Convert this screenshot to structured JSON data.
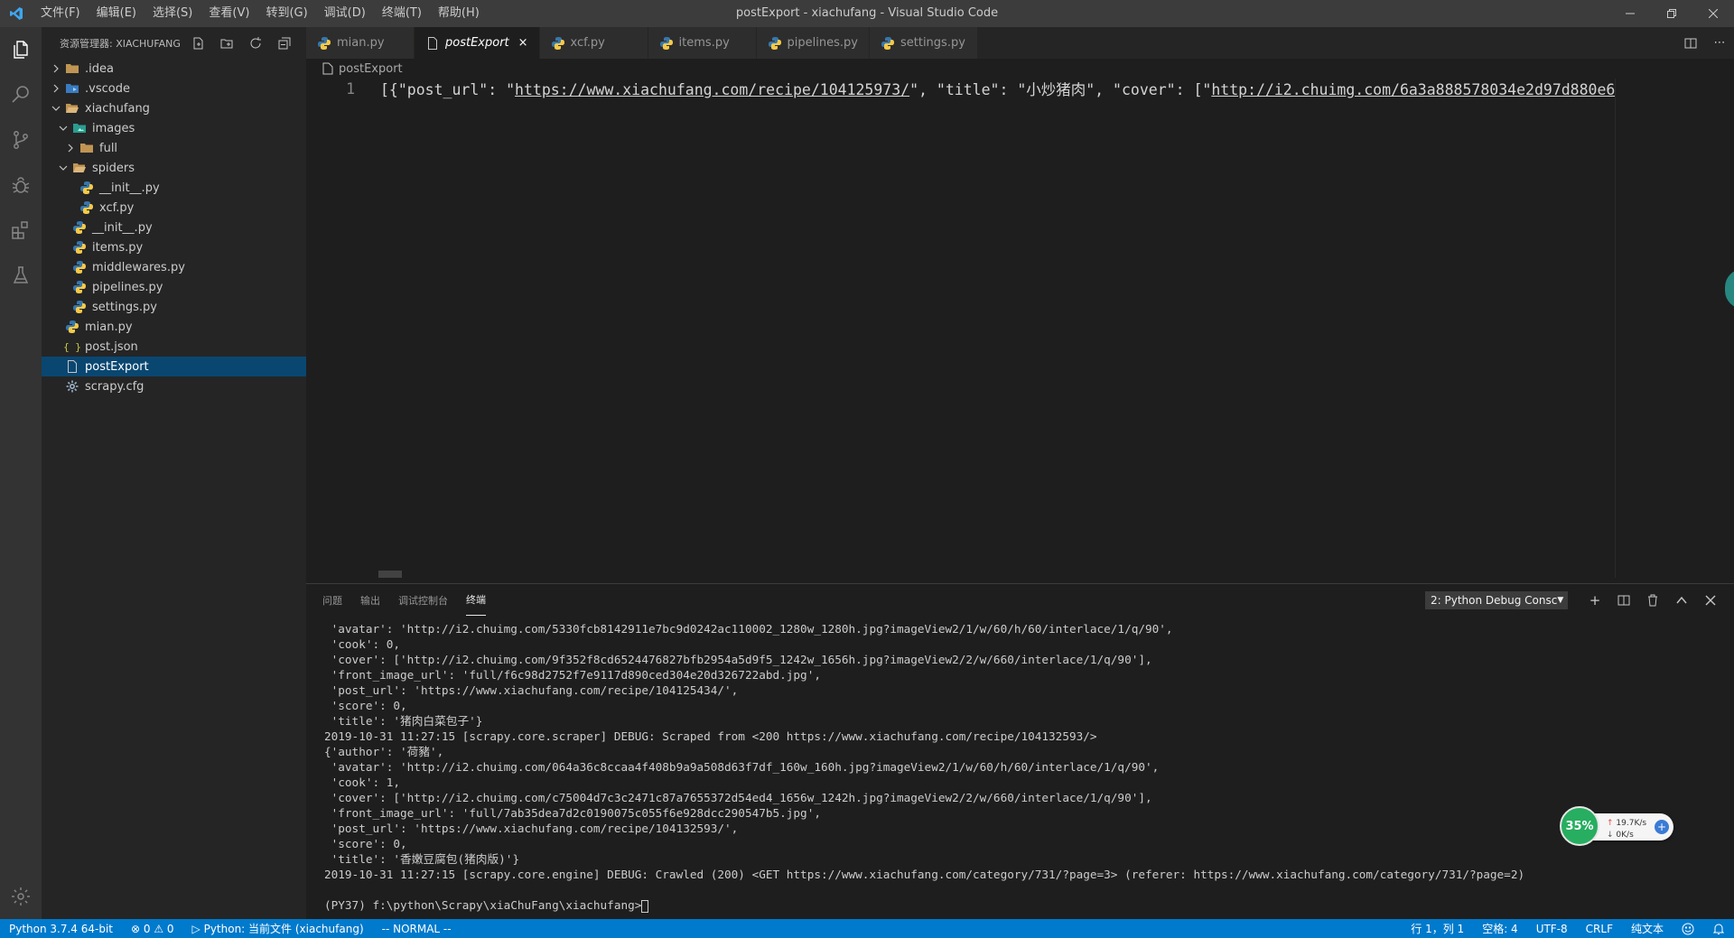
{
  "window": {
    "title": "postExport - xiachufang - Visual Studio Code",
    "menu": [
      "文件(F)",
      "编辑(E)",
      "选择(S)",
      "查看(V)",
      "转到(G)",
      "调试(D)",
      "终端(T)",
      "帮助(H)"
    ]
  },
  "sidebar": {
    "title": "资源管理器: XIACHUFANG",
    "tree": [
      {
        "label": ".idea",
        "indent": 0,
        "chevron": "right",
        "icon": "folder-icon"
      },
      {
        "label": ".vscode",
        "indent": 0,
        "chevron": "right",
        "icon": "folder-vscode-icon"
      },
      {
        "label": "xiachufang",
        "indent": 0,
        "chevron": "down",
        "icon": "folder-open-icon"
      },
      {
        "label": "images",
        "indent": 1,
        "chevron": "down",
        "icon": "folder-images-icon"
      },
      {
        "label": "full",
        "indent": 2,
        "chevron": "right",
        "icon": "folder-icon"
      },
      {
        "label": "spiders",
        "indent": 1,
        "chevron": "down",
        "icon": "folder-open-icon"
      },
      {
        "label": "__init__.py",
        "indent": 2,
        "chevron": "",
        "icon": "python-icon"
      },
      {
        "label": "xcf.py",
        "indent": 2,
        "chevron": "",
        "icon": "python-icon"
      },
      {
        "label": "__init__.py",
        "indent": 1,
        "chevron": "",
        "icon": "python-icon"
      },
      {
        "label": "items.py",
        "indent": 1,
        "chevron": "",
        "icon": "python-icon"
      },
      {
        "label": "middlewares.py",
        "indent": 1,
        "chevron": "",
        "icon": "python-icon"
      },
      {
        "label": "pipelines.py",
        "indent": 1,
        "chevron": "",
        "icon": "python-icon"
      },
      {
        "label": "settings.py",
        "indent": 1,
        "chevron": "",
        "icon": "python-icon"
      },
      {
        "label": "mian.py",
        "indent": 0,
        "chevron": "",
        "icon": "python-icon"
      },
      {
        "label": "post.json",
        "indent": 0,
        "chevron": "",
        "icon": "json-icon"
      },
      {
        "label": "postExport",
        "indent": 0,
        "chevron": "",
        "icon": "file-icon",
        "selected": true
      },
      {
        "label": "scrapy.cfg",
        "indent": 0,
        "chevron": "",
        "icon": "gear-icon"
      }
    ]
  },
  "tabs": [
    {
      "label": "mian.py",
      "icon": "python-icon"
    },
    {
      "label": "postExport",
      "icon": "file-icon",
      "active": true
    },
    {
      "label": "xcf.py",
      "icon": "python-icon"
    },
    {
      "label": "items.py",
      "icon": "python-icon"
    },
    {
      "label": "pipelines.py",
      "icon": "python-icon"
    },
    {
      "label": "settings.py",
      "icon": "python-icon"
    }
  ],
  "editor": {
    "breadcrumb": "postExport",
    "line_number": "1",
    "code_parts": [
      {
        "text": "[{\"post_url\": \"",
        "u": false
      },
      {
        "text": "https://www.xiachufang.com/recipe/104125973/",
        "u": true
      },
      {
        "text": "\", \"title\": \"小炒猪肉\", \"cover\": [\"",
        "u": false
      },
      {
        "text": "http://i2.chuimg.com/6a3a888578034e2d97d880e6",
        "u": true
      }
    ]
  },
  "panel": {
    "tabs": [
      "问题",
      "输出",
      "调试控制台",
      "终端"
    ],
    "active_tab": 3,
    "terminal_select": "2: Python Debug Consc",
    "terminal_lines": [
      " 'avatar': 'http://i2.chuimg.com/5330fcb8142911e7bc9d0242ac110002_1280w_1280h.jpg?imageView2/1/w/60/h/60/interlace/1/q/90',",
      " 'cook': 0,",
      " 'cover': ['http://i2.chuimg.com/9f352f8cd6524476827bfb2954a5d9f5_1242w_1656h.jpg?imageView2/2/w/660/interlace/1/q/90'],",
      " 'front_image_url': 'full/f6c98d2752f7e9117d890ced304e20d326722abd.jpg',",
      " 'post_url': 'https://www.xiachufang.com/recipe/104125434/',",
      " 'score': 0,",
      " 'title': '猪肉白菜包子'}",
      "2019-10-31 11:27:15 [scrapy.core.scraper] DEBUG: Scraped from <200 https://www.xiachufang.com/recipe/104132593/>",
      "{'author': '荷豬',",
      " 'avatar': 'http://i2.chuimg.com/064a36c8ccaa4f408b9a9a508d63f7df_160w_160h.jpg?imageView2/1/w/60/h/60/interlace/1/q/90',",
      " 'cook': 1,",
      " 'cover': ['http://i2.chuimg.com/c75004d7c3c2471c87a7655372d54ed4_1656w_1242h.jpg?imageView2/2/w/660/interlace/1/q/90'],",
      " 'front_image_url': 'full/7ab35dea7d2c0190075c055f6e928dcc290547b5.jpg',",
      " 'post_url': 'https://www.xiachufang.com/recipe/104132593/',",
      " 'score': 0,",
      " 'title': '香嫩豆腐包(猪肉版)'}",
      "2019-10-31 11:27:15 [scrapy.core.engine] DEBUG: Crawled (200) <GET https://www.xiachufang.com/category/731/?page=3> (referer: https://www.xiachufang.com/category/731/?page=2)",
      "",
      "(PY37) f:\\python\\Scrapy\\xiaChuFang\\xiachufang>"
    ]
  },
  "statusbar": {
    "python": "Python 3.7.4 64-bit",
    "problems": "⊗ 0 ⚠ 0",
    "run": "▷ Python: 当前文件 (xiachufang)",
    "mode": "-- NORMAL --",
    "position": "行 1，列 1",
    "spaces": "空格: 4",
    "encoding": "UTF-8",
    "eol": "CRLF",
    "language": "纯文本"
  },
  "widget": {
    "percent": "35%",
    "up": "19.7K/s",
    "down": "0K/s"
  },
  "colors": {
    "statusbar": "#007acc",
    "selection": "#094771",
    "activitybar": "#333333"
  }
}
